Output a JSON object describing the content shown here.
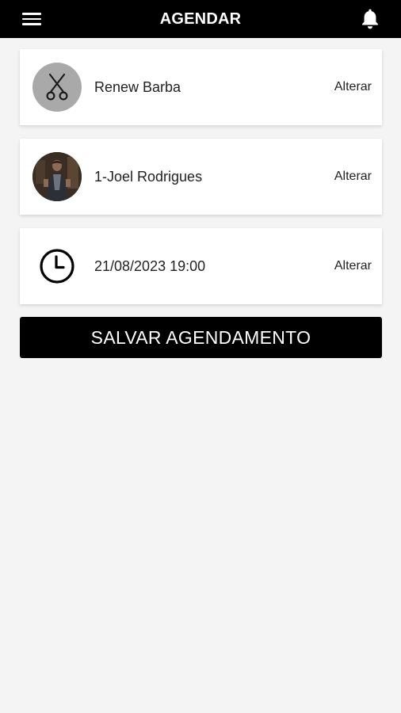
{
  "header": {
    "title": "AGENDAR",
    "menu_icon": "hamburger-menu-icon",
    "notification_icon": "bell-icon"
  },
  "booking": {
    "service": {
      "label": "Renew Barba",
      "action": "Alterar",
      "icon": "scissors-icon"
    },
    "barber": {
      "label": "1-Joel Rodrigues",
      "action": "Alterar",
      "icon": "barber-avatar"
    },
    "datetime": {
      "label": "21/08/2023 19:00",
      "action": "Alterar",
      "icon": "clock-icon"
    }
  },
  "save_button": {
    "label": "SALVAR AGENDAMENTO"
  },
  "colors": {
    "header_bg": "#000000",
    "page_bg": "#f4f4f4",
    "card_bg": "#ffffff",
    "button_bg": "#000000",
    "service_avatar_bg": "#a9a9a9"
  }
}
